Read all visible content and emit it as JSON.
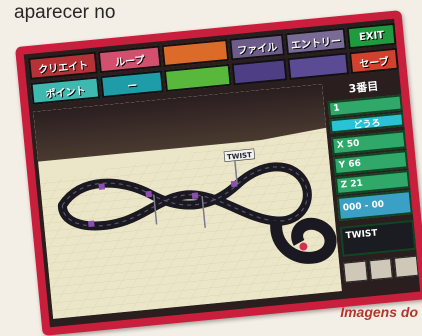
{
  "caption": {
    "top": "aparecer no",
    "bottom": "Imagens do"
  },
  "toolbar": {
    "row1": [
      "クリエイト",
      "ループ",
      "",
      "ファイル",
      "エントリー",
      "EXIT"
    ],
    "row2": [
      "ポイント",
      "ー",
      "",
      "",
      "",
      "セーブ"
    ]
  },
  "panel": {
    "header": "3番目",
    "field_value": "1",
    "mode_label": "どうろ",
    "x": "X 50",
    "y": "Y 66",
    "z": "Z 21",
    "range": "000 - 00",
    "track_name": "TWIST"
  },
  "viewport": {
    "flag_label": "TWIST"
  },
  "colors": {
    "frame": "#c91e3c",
    "track": "#1a1820",
    "ground": "#ece6c8",
    "panel_green": "#2fa86a",
    "panel_cyan": "#2ac2d6"
  }
}
